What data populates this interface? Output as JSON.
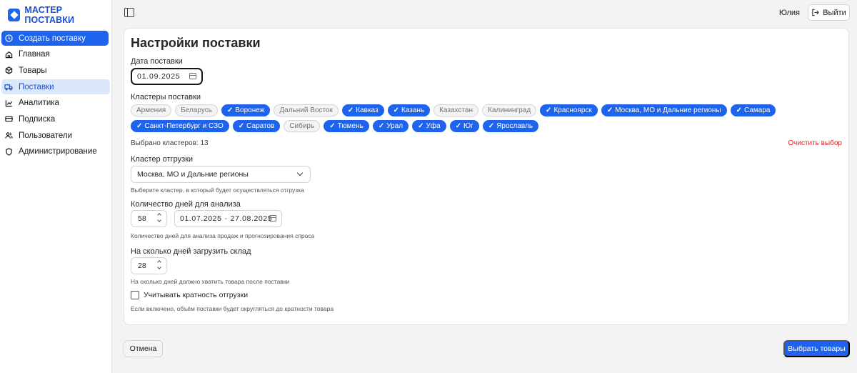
{
  "brand": {
    "title": "МАСТЕР ПОСТАВКИ"
  },
  "sidebar": {
    "items": [
      {
        "label": "Создать поставку",
        "icon": "plus-circle-icon",
        "state": "active"
      },
      {
        "label": "Главная",
        "icon": "home-icon",
        "state": ""
      },
      {
        "label": "Товары",
        "icon": "package-icon",
        "state": ""
      },
      {
        "label": "Поставки",
        "icon": "truck-icon",
        "state": "selected"
      },
      {
        "label": "Аналитика",
        "icon": "chart-line-icon",
        "state": ""
      },
      {
        "label": "Подписка",
        "icon": "credit-card-icon",
        "state": ""
      },
      {
        "label": "Пользователи",
        "icon": "users-icon",
        "state": ""
      },
      {
        "label": "Администрирование",
        "icon": "shield-icon",
        "state": ""
      }
    ]
  },
  "header": {
    "user_name": "Юлия",
    "logout_label": "Выйти"
  },
  "main": {
    "title": "Настройки поставки",
    "delivery_date": {
      "label": "Дата поставки",
      "value": "01.09.2025"
    },
    "clusters": {
      "label": "Кластеры поставки",
      "row1": [
        {
          "label": "Армения",
          "selected": false
        },
        {
          "label": "Беларусь",
          "selected": false
        },
        {
          "label": "Воронеж",
          "selected": true
        },
        {
          "label": "Дальний Восток",
          "selected": false
        },
        {
          "label": "Кавказ",
          "selected": true
        },
        {
          "label": "Казань",
          "selected": true
        },
        {
          "label": "Казахстан",
          "selected": false
        },
        {
          "label": "Калининград",
          "selected": false
        },
        {
          "label": "Красноярск",
          "selected": true
        },
        {
          "label": "Москва, МО и Дальние регионы",
          "selected": true
        },
        {
          "label": "Самара",
          "selected": true
        }
      ],
      "row2": [
        {
          "label": "Санкт-Петербург и СЗО",
          "selected": true
        },
        {
          "label": "Саратов",
          "selected": true
        },
        {
          "label": "Сибирь",
          "selected": false
        },
        {
          "label": "Тюмень",
          "selected": true
        },
        {
          "label": "Урал",
          "selected": true
        },
        {
          "label": "Уфа",
          "selected": true
        },
        {
          "label": "Юг",
          "selected": true
        },
        {
          "label": "Ярославль",
          "selected": true
        }
      ],
      "count_text": "Выбрано кластеров: 13",
      "clear_label": "Очистить выбор"
    },
    "shipping_cluster": {
      "label": "Кластер отгрузки",
      "value": "Москва, МО и Дальние регионы",
      "hint": "Выберите кластер, в который будет осуществляться отгрузка"
    },
    "analysis_days": {
      "label": "Количество дней для анализа",
      "value": "58",
      "range_start": "01.07.2025",
      "range_sep": "-",
      "range_end": "27.08.2025",
      "hint": "Количество дней для анализа продаж и прогнозирования спроса"
    },
    "stock_days": {
      "label": "На сколько дней загрузить склад",
      "value": "28",
      "hint": "На сколько дней должно хватить товара после поставки"
    },
    "multiplicity": {
      "label": "Учитывать кратность отгрузки",
      "checked": false,
      "hint": "Если включено, объём поставки будет округляться до кратности товара"
    }
  },
  "footer": {
    "cancel_label": "Отмена",
    "submit_label": "Выбрать товары"
  },
  "colors": {
    "accent": "#1d63ed",
    "danger": "#dc2626"
  }
}
